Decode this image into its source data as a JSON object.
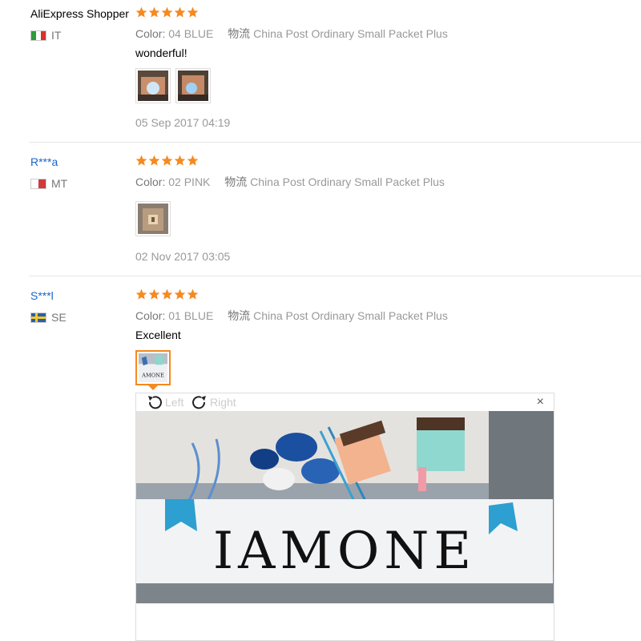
{
  "labels": {
    "color": "Color:",
    "shipping": "物流"
  },
  "reviews": [
    {
      "user": "AliExpress Shopper",
      "country": "IT",
      "rating": 5,
      "color_value": "04 BLUE",
      "shipping_value": "China Post Ordinary Small Packet Plus",
      "comment": "wonderful!",
      "date": "05 Sep 2017 04:19"
    },
    {
      "user": "R***a",
      "country": "MT",
      "rating": 5,
      "color_value": "02 PINK",
      "shipping_value": "China Post Ordinary Small Packet Plus",
      "comment": "",
      "date": "02 Nov 2017 03:05"
    },
    {
      "user": "S***l",
      "country": "SE",
      "rating": 5,
      "color_value": "01 BLUE",
      "shipping_value": "China Post Ordinary Small Packet Plus",
      "comment": "Excellent"
    }
  ],
  "viewer": {
    "rotate_left": "Left",
    "rotate_right": "Right",
    "close": "×",
    "photo_text": "IAMONE"
  },
  "colors": {
    "star": "#f6891f",
    "link": "#1a66c8",
    "active_border": "#f6891f"
  }
}
